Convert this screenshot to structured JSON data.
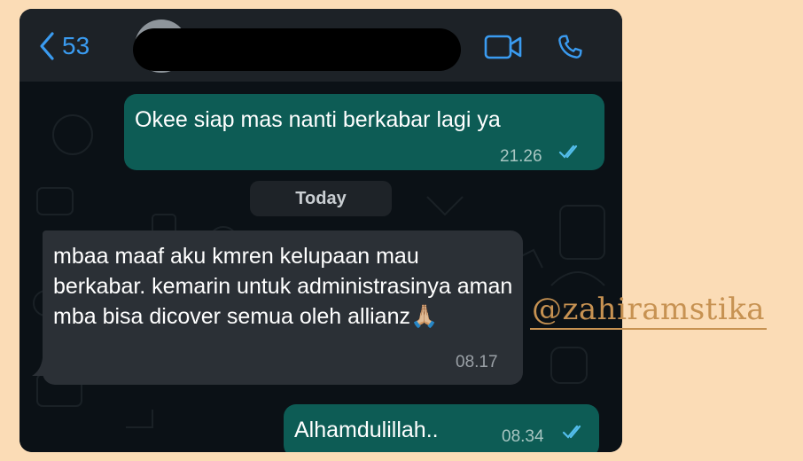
{
  "header": {
    "back_count": "53",
    "contact_name": ""
  },
  "messages": [
    {
      "direction": "outgoing",
      "text": "Okee siap mas nanti berkabar lagi ya",
      "time": "21.26",
      "status": "read"
    },
    {
      "direction": "incoming",
      "text": "mbaa maaf aku kmren kelupaan mau berkabar. kemarin untuk administrasinya aman mba bisa dicover semua oleh allianz",
      "emoji": "🙏🏼",
      "time": "08.17"
    },
    {
      "direction": "outgoing",
      "text": "Alhamdulillah..",
      "time": "08.34",
      "status": "read"
    }
  ],
  "day_separator": "Today",
  "watermark": "@zahiramstika",
  "colors": {
    "accent": "#3a9bf0",
    "outgoing_bubble": "#0d5c55",
    "incoming_bubble": "#2b3036",
    "read_ticks": "#53bdeb",
    "page_background": "#fbdcb6",
    "watermark": "#c79252"
  },
  "icons": [
    "chevron-left-icon",
    "avatar",
    "video-call-icon",
    "phone-icon",
    "double-check-icon",
    "folded-hands-emoji"
  ]
}
